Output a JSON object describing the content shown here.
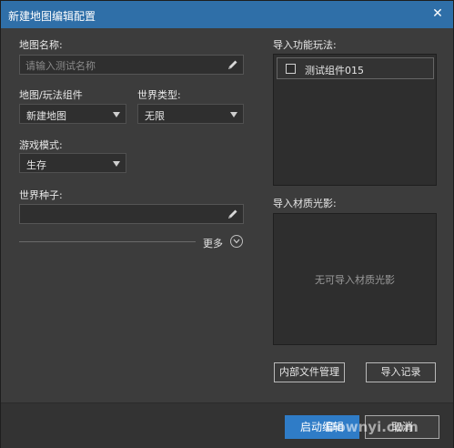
{
  "window": {
    "title": "新建地图编辑配置",
    "close_glyph": "✕"
  },
  "left": {
    "map_name": {
      "label": "地图名称:",
      "placeholder": "请输入测试名称",
      "value": ""
    },
    "map_component": {
      "label": "地图/玩法组件",
      "selected": "新建地图"
    },
    "world_type": {
      "label": "世界类型:",
      "selected": "无限"
    },
    "game_mode": {
      "label": "游戏模式:",
      "selected": "生存"
    },
    "world_seed": {
      "label": "世界种子:",
      "value": ""
    },
    "more_label": "更多"
  },
  "right": {
    "import_gameplay": {
      "label": "导入功能玩法:",
      "items": [
        {
          "label": "测试组件015",
          "checked": false
        }
      ]
    },
    "import_material": {
      "label": "导入材质光影:",
      "empty_text": "无可导入材质光影"
    },
    "internal_file_button": "内部文件管理",
    "import_record_button": "导入记录"
  },
  "footer": {
    "launch_editor_button": "启动编辑",
    "cancel_button": "取消"
  },
  "watermark": {
    "text": "Downyi.com"
  },
  "colors": {
    "titlebar": "#2f6fa8",
    "primary_button": "#2f7cc7",
    "background": "#3c3c3c"
  }
}
